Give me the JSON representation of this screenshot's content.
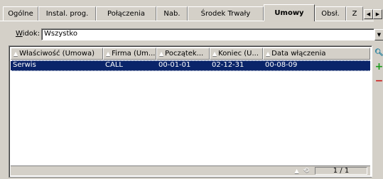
{
  "tabs": [
    {
      "label": "Ogólne",
      "active": false
    },
    {
      "label": "Instal. prog.",
      "active": false
    },
    {
      "label": "Połączenia",
      "active": false
    },
    {
      "label": "Nab.",
      "active": false
    },
    {
      "label": "Środek Trwały",
      "active": false
    },
    {
      "label": "Umowy",
      "active": true
    },
    {
      "label": "Obsł.",
      "active": false
    },
    {
      "label": "Z",
      "active": false
    }
  ],
  "filter": {
    "label_underlined": "W",
    "label_rest": "idok:",
    "value": "Wszystko"
  },
  "grid": {
    "columns": [
      "Właściwość (Umowa)",
      "Firma (Um...",
      "Początek...",
      "Koniec (U...",
      "Data włączenia"
    ],
    "rows": [
      [
        "Serwis",
        "CALL",
        "00-01-01",
        "02-12-31",
        "00-08-09"
      ]
    ]
  },
  "status": {
    "pager": "1 / 1"
  },
  "icons": {
    "sort": "sort-triangle-icon",
    "tab_prev": "chevron-left-icon",
    "tab_next": "chevron-right-icon",
    "dropdown": "chevron-down-icon",
    "search": "magnifier-icon",
    "add": "plus-icon",
    "remove": "minus-icon"
  },
  "colors": {
    "selection": "#0a246a",
    "add": "#1a9a1a",
    "remove": "#cc1a1a"
  }
}
